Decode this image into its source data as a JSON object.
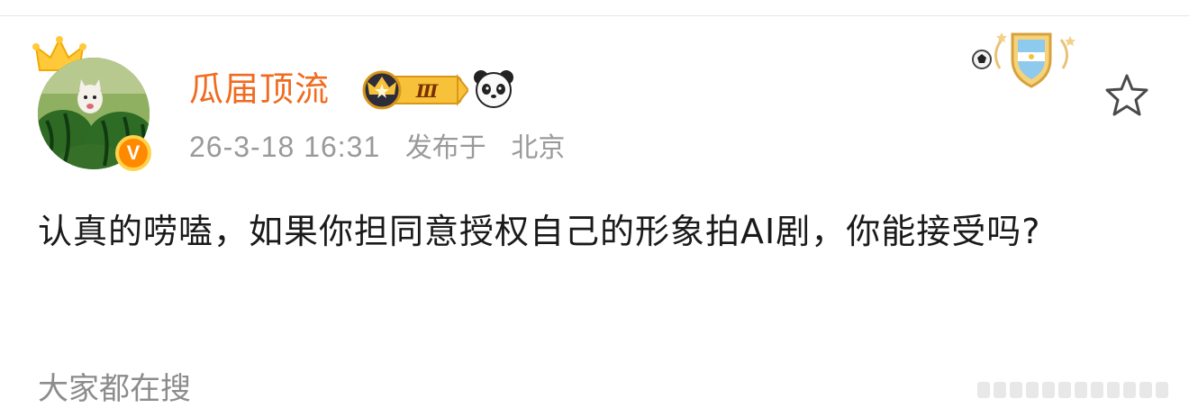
{
  "user": {
    "name": "瓜届顶流",
    "level": "Ⅲ",
    "verified_badge": "V",
    "timestamp": "26-3-18 16:31",
    "published_in": "发布于",
    "location": "北京"
  },
  "post": {
    "text": "认真的唠嗑，如果你担同意授权自己的形象拍AI剧，你能接受吗?"
  },
  "footer": {
    "search_label": "大家都在搜"
  },
  "icons": {
    "favorite": "star-outline-icon",
    "medal": "shield-medal-icon",
    "panda": "panda-icon",
    "crown": "crown-icon"
  },
  "colors": {
    "username": "#f06b1f",
    "meta": "#9a9a9a",
    "body_text": "#1a1a1a",
    "verified": "#ff8a00"
  }
}
